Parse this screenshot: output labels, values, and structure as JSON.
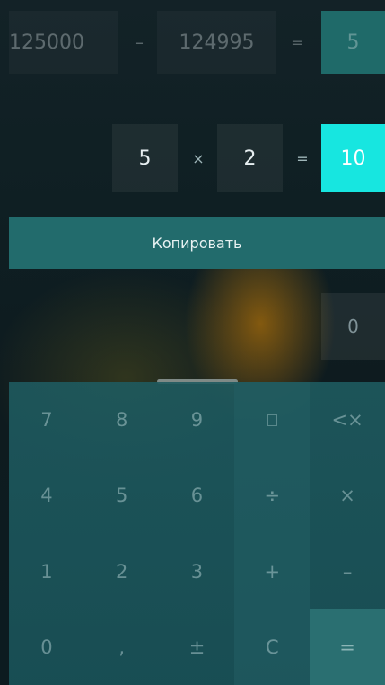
{
  "row1": {
    "operand1": "125000",
    "operator": "–",
    "operand2": "124995",
    "equals": "=",
    "result": "5"
  },
  "row2": {
    "operand1": "5",
    "operator": "×",
    "operand2": "2",
    "equals": "=",
    "result": "10"
  },
  "copy_button": "Копировать",
  "memory_value": "0",
  "keys": [
    [
      "7",
      "8",
      "9",
      "",
      "<×"
    ],
    [
      "4",
      "5",
      "6",
      "÷",
      "×"
    ],
    [
      "1",
      "2",
      "3",
      "+",
      "–"
    ],
    [
      "0",
      ",",
      "±",
      "C",
      "="
    ]
  ],
  "colors": {
    "accent": "#17e6e0",
    "copy_bg": "#226b6c",
    "keypad_bg": "#1e5a5f"
  }
}
